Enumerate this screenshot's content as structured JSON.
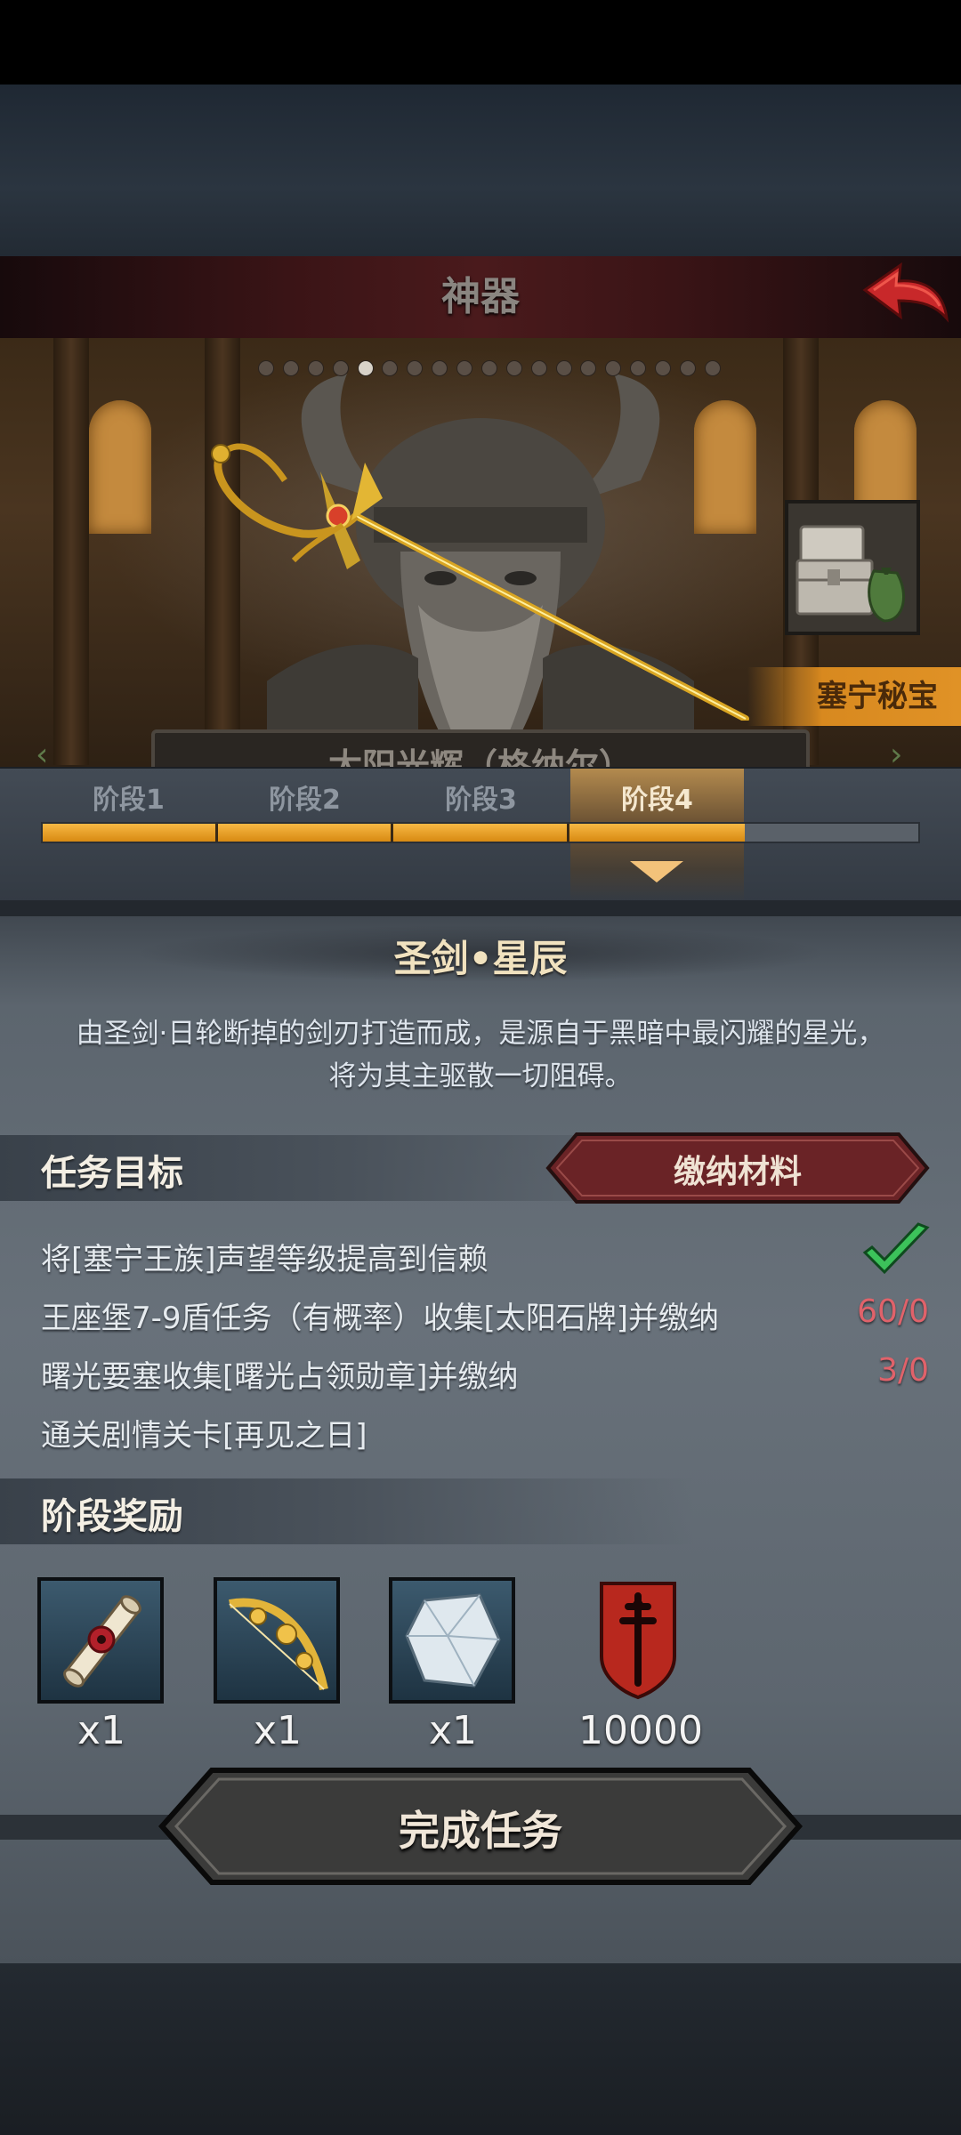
{
  "header": {
    "title": "神器"
  },
  "artifact": {
    "name": "太阳光辉（格纳尔）",
    "treasure_label": "塞宁秘宝"
  },
  "stages": [
    {
      "label": "阶段1"
    },
    {
      "label": "阶段2"
    },
    {
      "label": "阶段3"
    },
    {
      "label": "阶段4"
    }
  ],
  "stage_progress": {
    "completed": 4,
    "total": 5
  },
  "stage_detail": {
    "name": "圣剑•星辰",
    "description_line1": "由圣剑·日轮断掉的剑刃打造而成，是源自于黑暗中最闪耀的星光，",
    "description_line2": "将为其主驱散一切阻碍。"
  },
  "tasks": {
    "title": "任务目标",
    "submit_button": "缴纳材料",
    "items": [
      {
        "text": "将[塞宁王族]声望等级提高到信赖",
        "progress": ""
      },
      {
        "text": "王座堡7-9盾任务（有概率）收集[太阳石牌]并缴纳",
        "progress": "60/0"
      },
      {
        "text": "曙光要塞收集[曙光占领勋章]并缴纳",
        "progress": "3/0"
      },
      {
        "text": "通关剧情关卡[再见之日]",
        "progress": ""
      }
    ]
  },
  "rewards": {
    "title": "阶段奖励",
    "items": [
      {
        "icon": "scroll-icon",
        "qty": "x1"
      },
      {
        "icon": "golden-bow-icon",
        "qty": "x1"
      },
      {
        "icon": "crystal-icon",
        "qty": "x1"
      },
      {
        "icon": "red-shield-emblem-icon",
        "qty": "10000"
      }
    ]
  },
  "actions": {
    "complete": "完成任务"
  },
  "colors": {
    "progress_fill": "#f0a32c",
    "progress_value_text": "#e0626a",
    "check": "#3cc25a"
  }
}
